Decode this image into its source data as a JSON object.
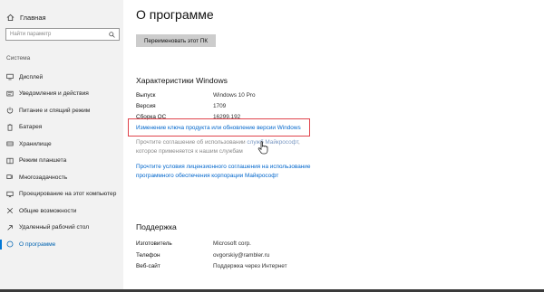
{
  "sidebar": {
    "home_label": "Главная",
    "search_placeholder": "Найти параметр",
    "section_label": "Система",
    "items": [
      {
        "label": "Дисплей",
        "icon": "display-icon"
      },
      {
        "label": "Уведомления и действия",
        "icon": "notifications-icon"
      },
      {
        "label": "Питание и спящий режим",
        "icon": "power-icon"
      },
      {
        "label": "Батарея",
        "icon": "battery-icon"
      },
      {
        "label": "Хранилище",
        "icon": "storage-icon"
      },
      {
        "label": "Режим планшета",
        "icon": "tablet-mode-icon"
      },
      {
        "label": "Многозадачность",
        "icon": "multitasking-icon"
      },
      {
        "label": "Проецирование на этот компьютер",
        "icon": "projecting-icon"
      },
      {
        "label": "Общие возможности",
        "icon": "shared-experiences-icon"
      },
      {
        "label": "Удаленный рабочий стол",
        "icon": "remote-desktop-icon"
      },
      {
        "label": "О программе",
        "icon": "info-icon",
        "active": true
      }
    ]
  },
  "main": {
    "title": "О программе",
    "rename_button": "Переименовать этот ПК",
    "windows_specs": {
      "heading": "Характеристики Windows",
      "rows": [
        {
          "key": "Выпуск",
          "value": "Windows 10 Pro"
        },
        {
          "key": "Версия",
          "value": "1709"
        },
        {
          "key": "Сборка ОС",
          "value": "16299.192"
        }
      ],
      "change_key_link": "Изменение ключа продукта или обновление версии Windows",
      "services_note_before": "Прочтите соглашение об использовании ",
      "services_note_link": "служб Майкрософт",
      "services_note_after": ", которое применяется к нашим службам",
      "license_link": "Прочтите условия лицензионного соглашения на использование программного обеспечения корпорации Майкрософт"
    },
    "support": {
      "heading": "Поддержка",
      "rows": [
        {
          "key": "Изготовитель",
          "value": "Microsoft corp."
        },
        {
          "key": "Телефон",
          "value": "ovgorskiy@rambler.ru"
        },
        {
          "key": "Веб-сайт",
          "value": "Поддержка через Интернет"
        }
      ]
    }
  },
  "colors": {
    "accent": "#0078d7",
    "link": "#0066cc",
    "highlight_box": "#e0434b",
    "sidebar_bg": "#f2f2f2"
  }
}
